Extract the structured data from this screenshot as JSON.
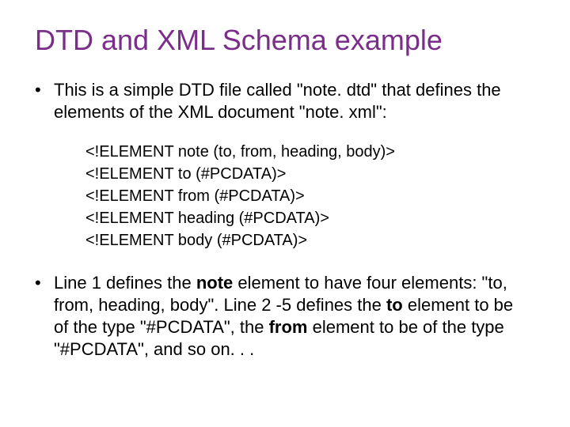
{
  "title": "DTD and XML Schema example",
  "bullets": {
    "b1": "This is a simple DTD file called \"note. dtd\" that defines the elements of the XML document \"note. xml\":",
    "b2": {
      "pre1": "Line 1 defines the ",
      "bold1": "note",
      "mid1": " element to have four elements: \"to, from, heading, body\". Line 2 -5 defines the ",
      "bold2": "to",
      "mid2": " element to be of the type \"#PCDATA\", the ",
      "bold3": "from",
      "mid3": " element to be of the type \"#PCDATA\", and so on. . ."
    }
  },
  "code": {
    "l1": "<!ELEMENT note (to, from, heading, body)>",
    "l2": "<!ELEMENT to (#PCDATA)>",
    "l3": "<!ELEMENT from (#PCDATA)>",
    "l4": "<!ELEMENT heading (#PCDATA)>",
    "l5": "<!ELEMENT body (#PCDATA)>"
  },
  "bullet_char": "•"
}
